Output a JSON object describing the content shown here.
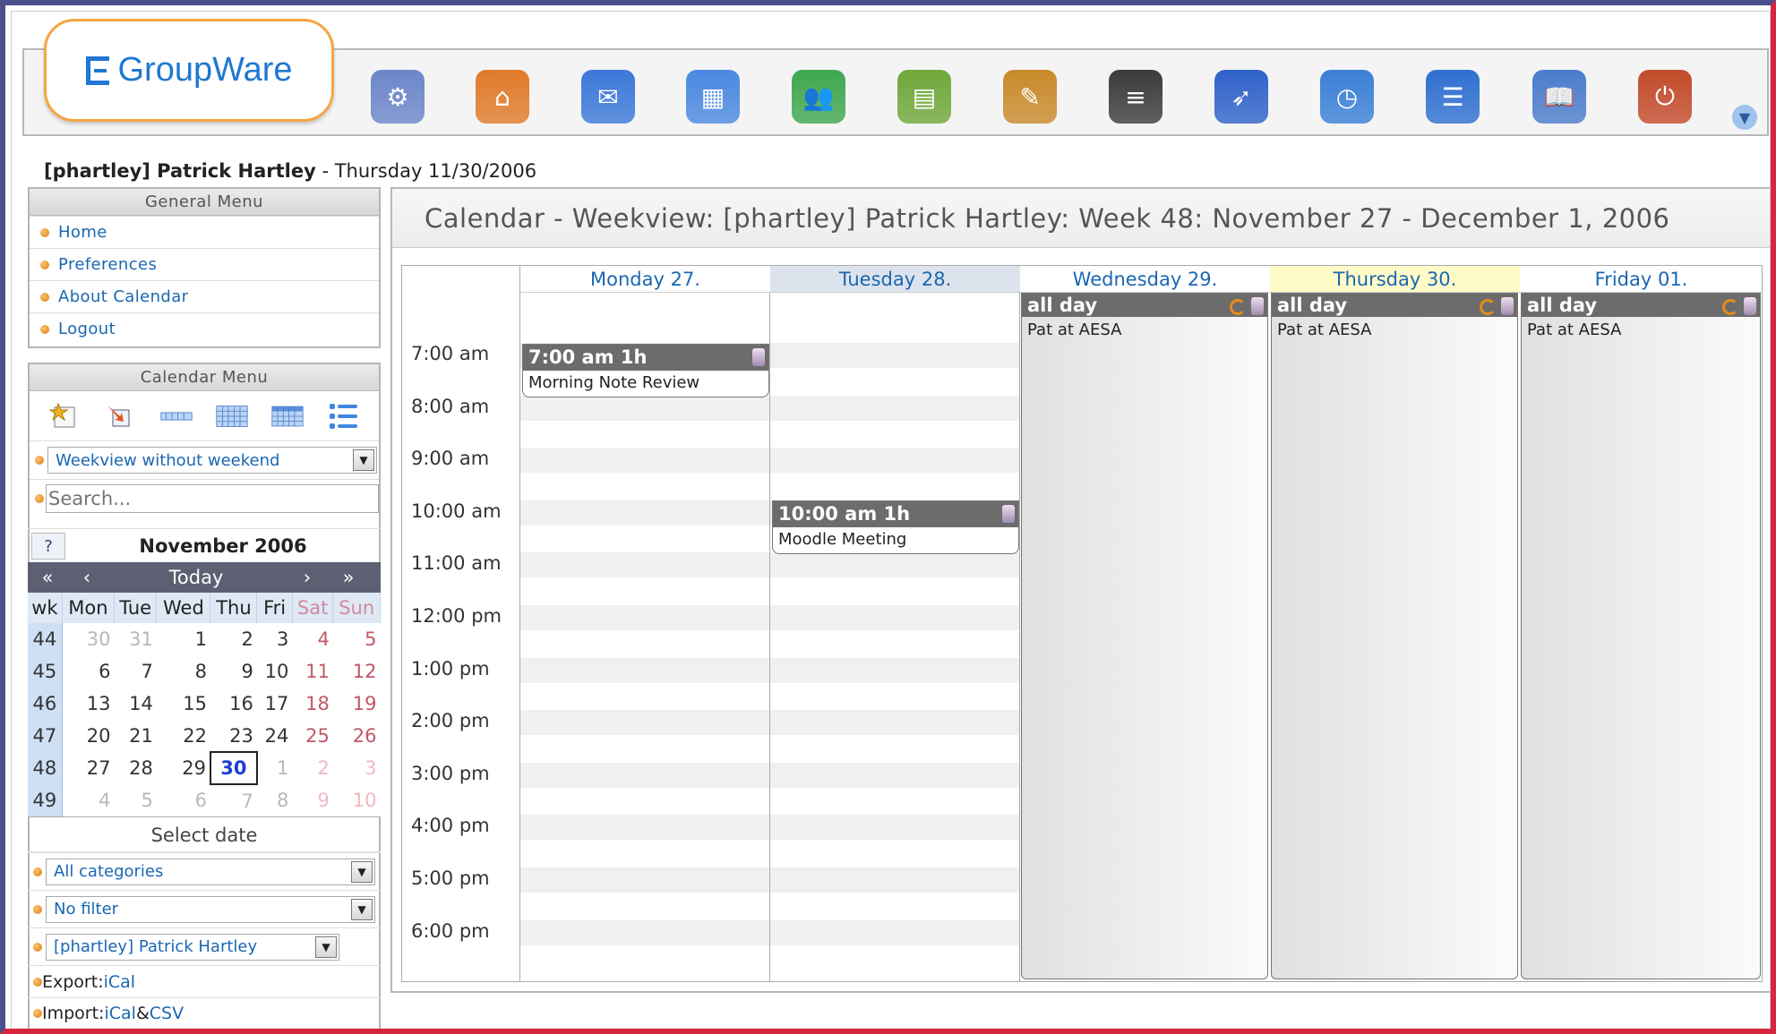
{
  "brand": {
    "name": "GroupWare"
  },
  "toolbar": {
    "apps": [
      {
        "icon": "admin-icon",
        "color": "#6b86c9",
        "glyph": "⚙"
      },
      {
        "icon": "home-icon",
        "color": "#e07a2a",
        "glyph": "⌂"
      },
      {
        "icon": "mail-icon",
        "color": "#3b78d8",
        "glyph": "✉"
      },
      {
        "icon": "calendar-icon",
        "color": "#4a88e0",
        "glyph": "▦"
      },
      {
        "icon": "addressbook-icon",
        "color": "#3fa74f",
        "glyph": "👥"
      },
      {
        "icon": "filemanager-icon",
        "color": "#6fa83a",
        "glyph": "▤"
      },
      {
        "icon": "infolog-icon",
        "color": "#c88a2a",
        "glyph": "✎"
      },
      {
        "icon": "projectmanager-icon",
        "color": "#3b3b3b",
        "glyph": "≡"
      },
      {
        "icon": "browser-icon",
        "color": "#2f62c9",
        "glyph": "➶"
      },
      {
        "icon": "timesheet-icon",
        "color": "#3a7fd6",
        "glyph": "◷"
      },
      {
        "icon": "tracker-icon",
        "color": "#2f6fd0",
        "glyph": "☰"
      },
      {
        "icon": "manual-icon",
        "color": "#4a7ccc",
        "glyph": "📖"
      },
      {
        "icon": "logout-icon",
        "color": "#c24a2a",
        "glyph": "⏻"
      }
    ]
  },
  "header": {
    "user": "[phartley] Patrick Hartley",
    "separator": " - ",
    "date": "Thursday 11/30/2006"
  },
  "general_menu": {
    "title": "General Menu",
    "items": [
      "Home",
      "Preferences",
      "About Calendar",
      "Logout"
    ]
  },
  "calendar_menu": {
    "title": "Calendar Menu",
    "view_select": "Weekview without weekend",
    "search_placeholder": "Search..."
  },
  "minical": {
    "help": "?",
    "month": "November 2006",
    "nav": {
      "first": "«",
      "prev": "‹",
      "today": "Today",
      "next": "›",
      "last": "»"
    },
    "headers": [
      "wk",
      "Mon",
      "Tue",
      "Wed",
      "Thu",
      "Fri",
      "Sat",
      "Sun"
    ],
    "weeks": [
      {
        "wk": "44",
        "days": [
          "30",
          "31",
          "1",
          "2",
          "3",
          "4",
          "5"
        ]
      },
      {
        "wk": "45",
        "days": [
          "6",
          "7",
          "8",
          "9",
          "10",
          "11",
          "12"
        ]
      },
      {
        "wk": "46",
        "days": [
          "13",
          "14",
          "15",
          "16",
          "17",
          "18",
          "19"
        ]
      },
      {
        "wk": "47",
        "days": [
          "20",
          "21",
          "22",
          "23",
          "24",
          "25",
          "26"
        ]
      },
      {
        "wk": "48",
        "days": [
          "27",
          "28",
          "29",
          "30",
          "1",
          "2",
          "3"
        ]
      },
      {
        "wk": "49",
        "days": [
          "4",
          "5",
          "6",
          "7",
          "8",
          "9",
          "10"
        ]
      }
    ],
    "select_date": "Select date"
  },
  "filters": {
    "category": "All categories",
    "filter": "No filter",
    "owner": "[phartley] Patrick Hartley"
  },
  "export": {
    "label": "Export: ",
    "link": "iCal"
  },
  "import": {
    "label": "Import: ",
    "link1": "iCal",
    "amp": " & ",
    "link2": "CSV"
  },
  "main": {
    "title": "Calendar - Weekview: [phartley] Patrick Hartley: Week 48: November 27 - December 1, 2006",
    "days": [
      "Monday 27.",
      "Tuesday 28.",
      "Wednesday 29.",
      "Thursday 30.",
      "Friday 01."
    ],
    "times": [
      "7:00 am",
      "8:00 am",
      "9:00 am",
      "10:00 am",
      "11:00 am",
      "12:00 pm",
      "1:00 pm",
      "2:00 pm",
      "3:00 pm",
      "4:00 pm",
      "5:00 pm",
      "6:00 pm"
    ],
    "events": [
      {
        "head": "7:00 am 1h",
        "title": "Morning Note Review"
      },
      {
        "head": "10:00 am 1h",
        "title": "Moodle Meeting"
      }
    ],
    "allday": [
      {
        "head": "all day",
        "title": "Pat at AESA"
      },
      {
        "head": "all day",
        "title": "Pat at AESA"
      },
      {
        "head": "all day",
        "title": "Pat at AESA"
      }
    ]
  }
}
